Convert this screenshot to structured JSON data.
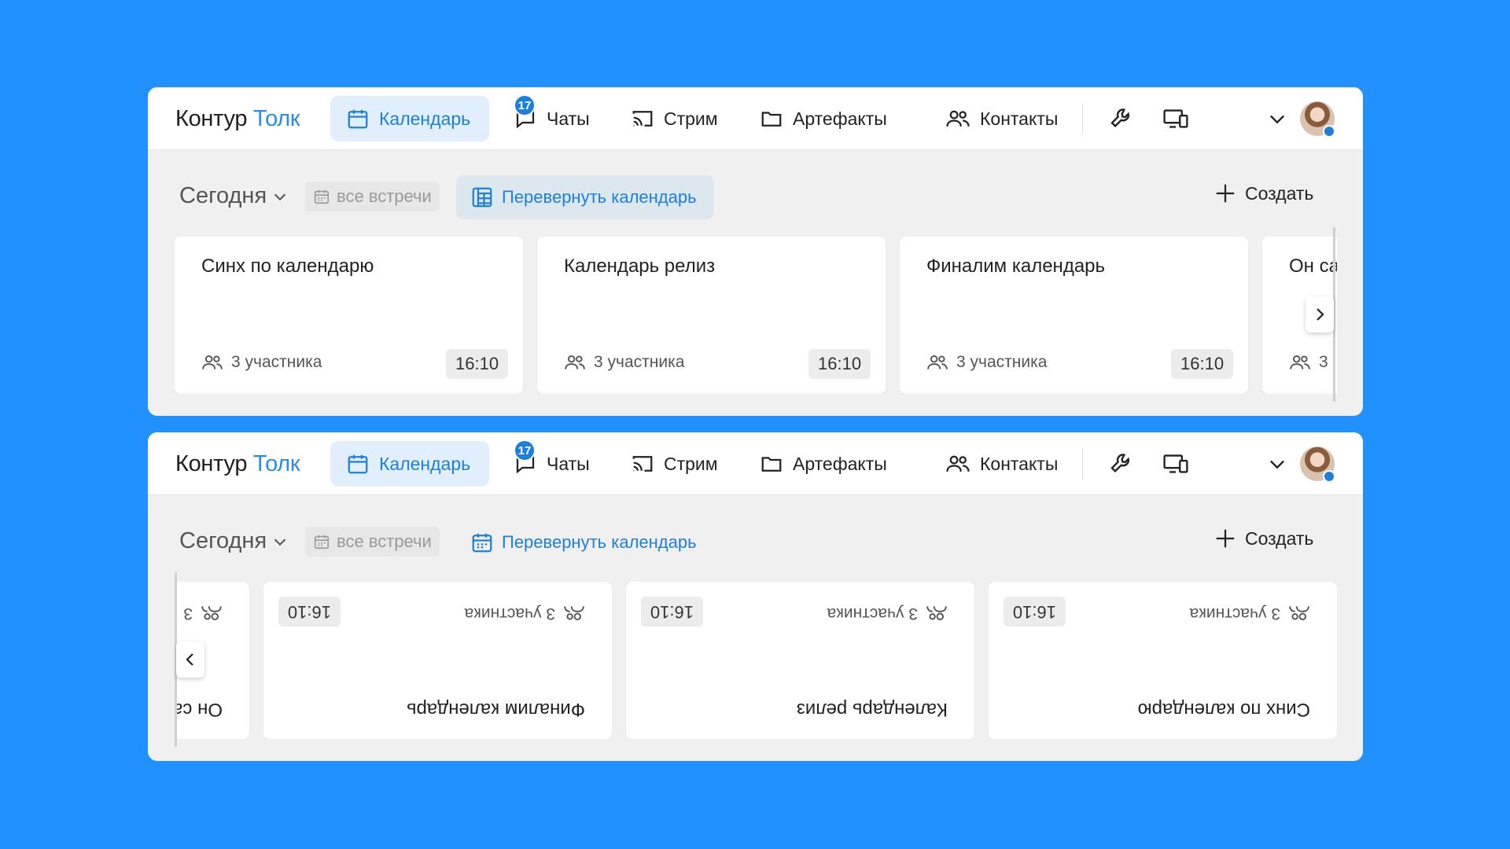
{
  "app": {
    "brand_part1": "Контур",
    "brand_part2": "Толк"
  },
  "nav": {
    "calendar": "Календарь",
    "chats": "Чаты",
    "chats_badge": "17",
    "stream": "Стрим",
    "artifacts": "Артефакты",
    "contacts": "Контакты"
  },
  "toolbar": {
    "today": "Сегодня",
    "all_meetings": "все встречи",
    "flip": "Перевернуть календарь",
    "create": "Создать"
  },
  "cards": [
    {
      "title": "Синх по календарю",
      "participants": "3 участника",
      "time": "16:10"
    },
    {
      "title": "Календарь релиз",
      "participants": "3 участника",
      "time": "16:10"
    },
    {
      "title": "Финалим календарь",
      "participants": "3 участника",
      "time": "16:10"
    },
    {
      "title": "Он са",
      "participants": "3",
      "time": ""
    }
  ],
  "colors": {
    "background": "#2191ff",
    "accent": "#1e7fd8",
    "panel": "#f0f0f0"
  },
  "icons": [
    "calendar-icon",
    "chat-icon",
    "cast-icon",
    "folder-icon",
    "users-icon",
    "wrench-icon",
    "devices-icon",
    "chevron-down-icon",
    "plus-icon",
    "flip-calendar-icon",
    "chevron-right-icon",
    "chevron-left-icon"
  ]
}
